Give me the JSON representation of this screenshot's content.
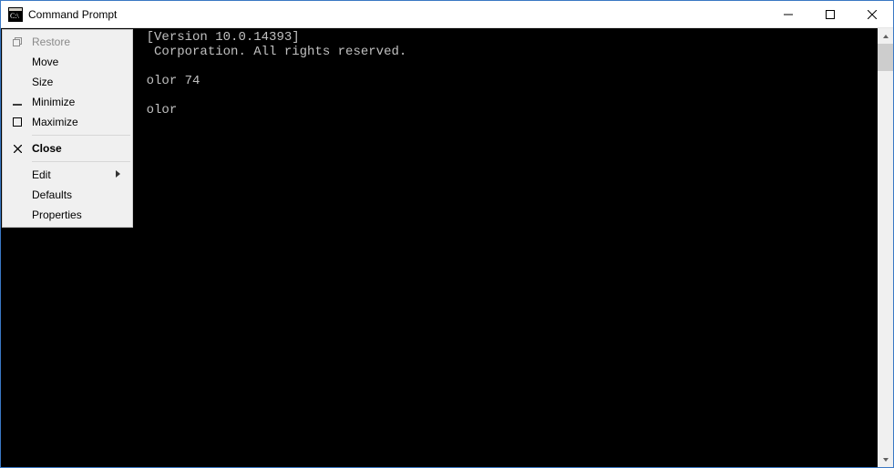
{
  "title": "Command Prompt",
  "console": {
    "lines": [
      "                   [Version 10.0.14393]",
      "                    Corporation. All rights reserved.",
      "",
      "                   olor 74",
      "",
      "                   olor",
      ""
    ]
  },
  "sysmenu": {
    "restore": "Restore",
    "move": "Move",
    "size": "Size",
    "minimize": "Minimize",
    "maximize": "Maximize",
    "close": "Close",
    "edit": "Edit",
    "defaults": "Defaults",
    "properties": "Properties"
  }
}
